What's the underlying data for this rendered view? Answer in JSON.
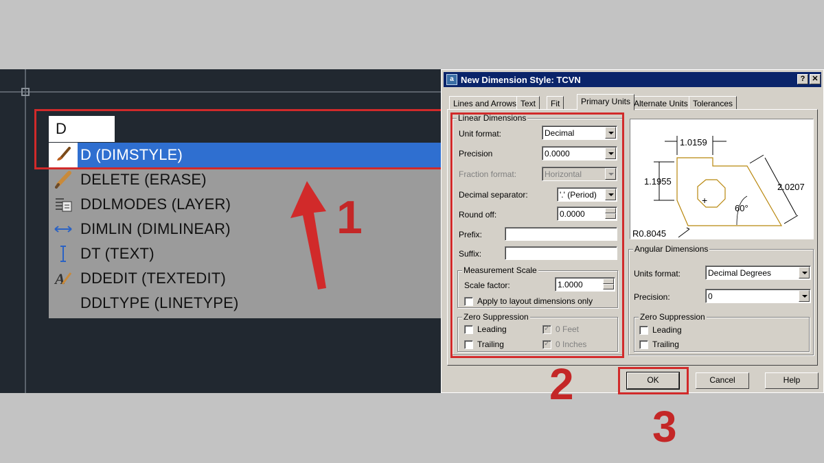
{
  "cad_panel": {
    "input_value": "D",
    "commands": [
      {
        "label": "D (DIMSTYLE)",
        "icon": "dimstyle-brush-icon",
        "selected": true
      },
      {
        "label": "DELETE (ERASE)",
        "icon": "eraser-pencil-icon",
        "selected": false
      },
      {
        "label": "DDLMODES (LAYER)",
        "icon": "layers-icon",
        "selected": false
      },
      {
        "label": "DIMLIN (DIMLINEAR)",
        "icon": "linear-dimension-icon",
        "selected": false
      },
      {
        "label": "DT (TEXT)",
        "icon": "text-cursor-icon",
        "selected": false
      },
      {
        "label": "DDEDIT (TEXTEDIT)",
        "icon": "text-edit-icon",
        "selected": false
      },
      {
        "label": "DDLTYPE (LINETYPE)",
        "icon": "",
        "selected": false
      }
    ]
  },
  "annotations": {
    "step1": "1",
    "step2": "2",
    "step3": "3",
    "color": "#d12a2a"
  },
  "dialog": {
    "title": "New Dimension Style: TCVN",
    "help_btn": "?",
    "close_btn": "✕",
    "tabs": [
      "Lines and Arrows",
      "Text",
      "Fit",
      "Primary Units",
      "Alternate Units",
      "Tolerances"
    ],
    "active_tab": "Primary Units",
    "linear": {
      "group_title": "Linear Dimensions",
      "unit_format_label": "Unit format:",
      "unit_format_value": "Decimal",
      "precision_label": "Precision",
      "precision_value": "0.0000",
      "fraction_label": "Fraction format:",
      "fraction_value": "Horizontal",
      "decimal_sep_label": "Decimal separator:",
      "decimal_sep_value": "'.' (Period)",
      "round_off_label": "Round off:",
      "round_off_value": "0.0000",
      "prefix_label": "Prefix:",
      "suffix_label": "Suffix:",
      "measurement": {
        "group_title": "Measurement Scale",
        "scale_label": "Scale factor:",
        "scale_value": "1.0000",
        "apply_layout_label": "Apply to layout dimensions only"
      },
      "zero": {
        "group_title": "Zero Suppression",
        "leading": "Leading",
        "trailing": "Trailing",
        "feet": "0 Feet",
        "inches": "0 Inches"
      }
    },
    "preview": {
      "dim_top": "1.0159",
      "dim_left": "1.1955",
      "dim_right": "2.0207",
      "angle": "60°",
      "radius": "R0.8045",
      "center_mark": "+"
    },
    "angular": {
      "group_title": "Angular Dimensions",
      "units_format_label": "Units format:",
      "units_format_value": "Decimal Degrees",
      "precision_label": "Precision:",
      "precision_value": "0",
      "zero": {
        "group_title": "Zero Suppression",
        "leading": "Leading",
        "trailing": "Trailing"
      }
    },
    "buttons": {
      "ok": "OK",
      "cancel": "Cancel",
      "help": "Help"
    }
  }
}
